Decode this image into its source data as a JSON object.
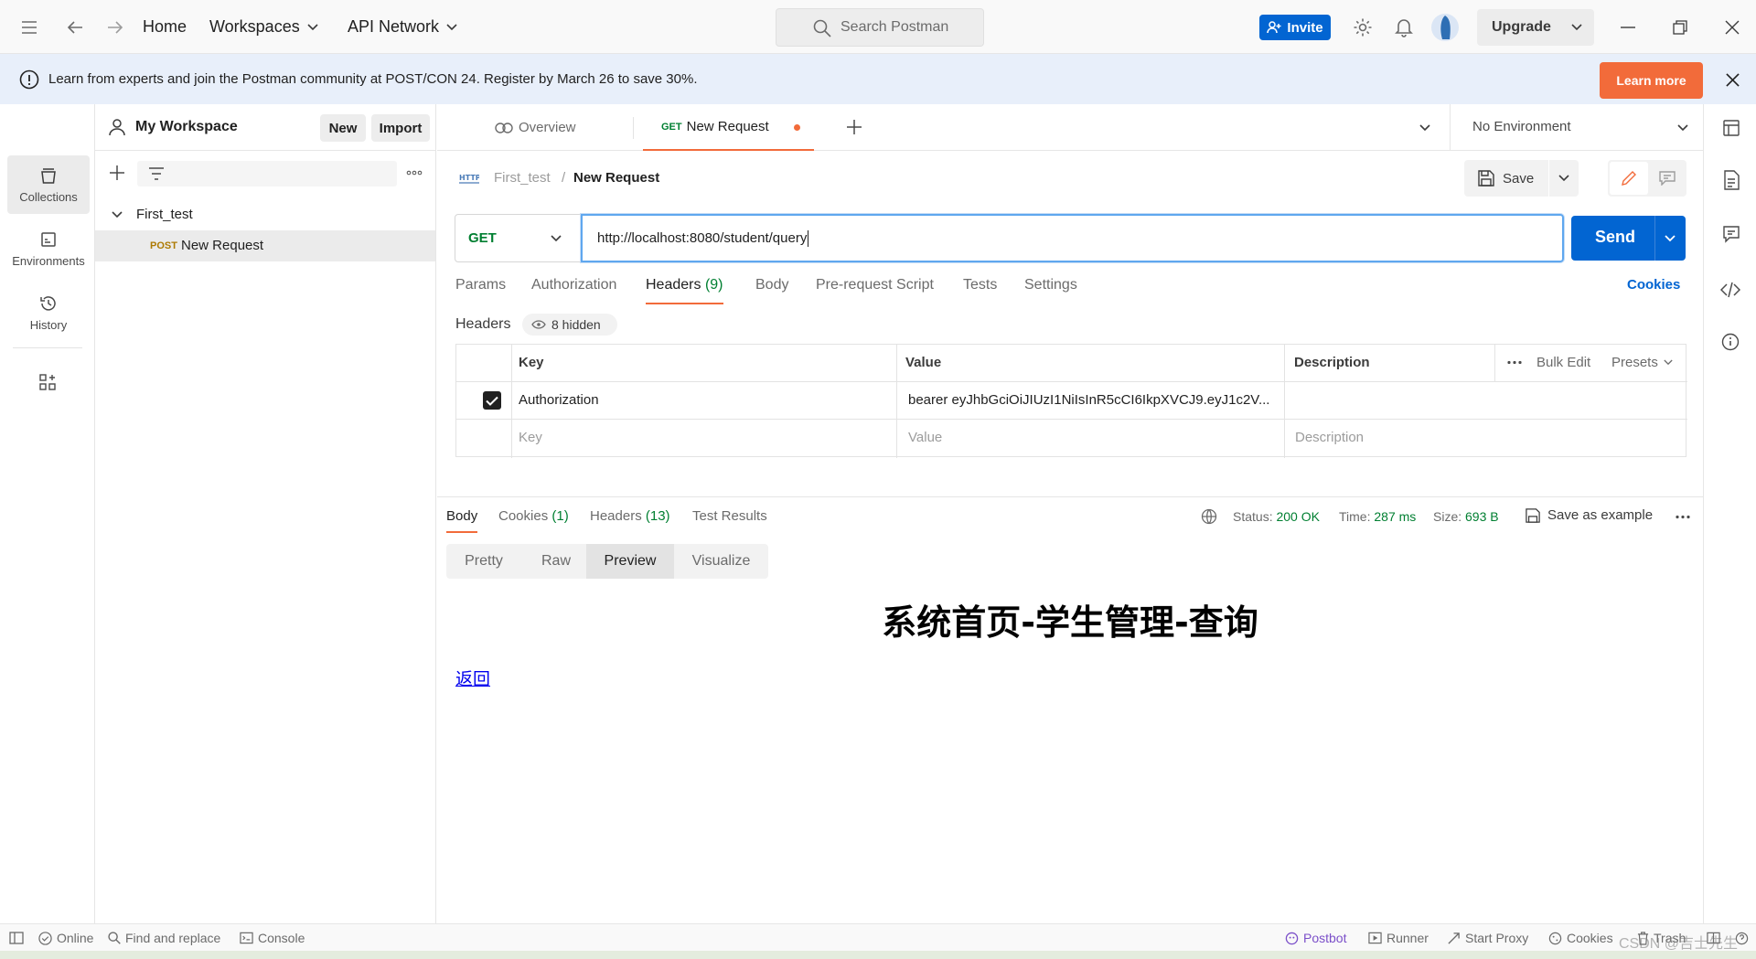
{
  "topbar": {
    "home": "Home",
    "workspaces": "Workspaces",
    "api_network": "API Network",
    "search_placeholder": "Search Postman",
    "invite": "Invite",
    "upgrade": "Upgrade"
  },
  "banner": {
    "text": "Learn from experts and join the Postman community at POST/CON 24. Register by March 26 to save 30%.",
    "cta": "Learn more"
  },
  "rail": {
    "collections": "Collections",
    "environments": "Environments",
    "history": "History"
  },
  "sidebar": {
    "workspace": "My Workspace",
    "new_btn": "New",
    "import_btn": "Import",
    "collection": "First_test",
    "request_method": "POST",
    "request_name": "New Request"
  },
  "tabs": {
    "overview": "Overview",
    "active_method": "GET",
    "active_name": "New Request",
    "environment": "No Environment"
  },
  "request": {
    "breadcrumb_parent": "First_test",
    "breadcrumb_sep": "/",
    "breadcrumb_current": "New Request",
    "save": "Save",
    "method": "GET",
    "url": "http://localhost:8080/student/query",
    "send": "Send",
    "tabs": {
      "params": "Params",
      "authorization": "Authorization",
      "headers": "Headers",
      "headers_count": "(9)",
      "body": "Body",
      "prerequest": "Pre-request Script",
      "tests": "Tests",
      "settings": "Settings",
      "cookies": "Cookies"
    },
    "headers_label": "Headers",
    "hidden": "8 hidden",
    "table": {
      "key": "Key",
      "value": "Value",
      "description": "Description",
      "bulk_edit": "Bulk Edit",
      "presets": "Presets",
      "row_key": "Authorization",
      "row_value": "bearer eyJhbGciOiJIUzI1NiIsInR5cCI6IkpXVCJ9.eyJ1c2V...",
      "ph_key": "Key",
      "ph_value": "Value",
      "ph_description": "Description"
    }
  },
  "response": {
    "tabs": {
      "body": "Body",
      "cookies": "Cookies",
      "cookies_count": "(1)",
      "headers": "Headers",
      "headers_count": "(13)",
      "tests": "Test Results"
    },
    "status_label": "Status:",
    "status_value": "200 OK",
    "time_label": "Time:",
    "time_value": "287 ms",
    "size_label": "Size:",
    "size_value": "693 B",
    "save_example": "Save as example",
    "views": {
      "pretty": "Pretty",
      "raw": "Raw",
      "preview": "Preview",
      "visualize": "Visualize"
    },
    "preview_title": "系统首页-学生管理-查询",
    "preview_link": "返回"
  },
  "statusbar": {
    "online": "Online",
    "find": "Find and replace",
    "console": "Console",
    "postbot": "Postbot",
    "runner": "Runner",
    "proxy": "Start Proxy",
    "cookies": "Cookies",
    "trash": "Trash",
    "watermark": "CSDN @吉士先生"
  },
  "colors": {
    "primary": "#0265d2",
    "accent": "#f26b3a",
    "get": "#007f31",
    "post": "#ad7a03",
    "status_ok": "#007f31"
  }
}
